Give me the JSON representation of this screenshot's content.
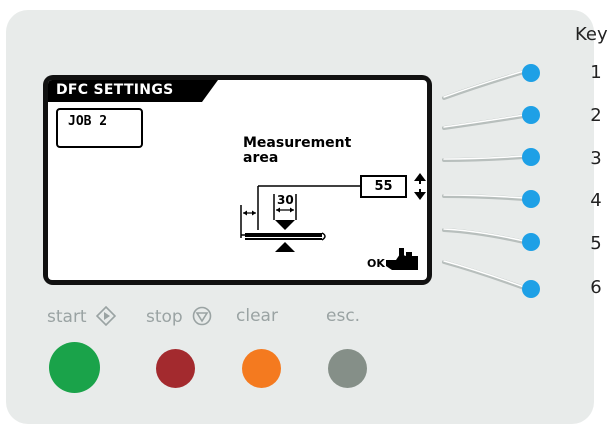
{
  "screen": {
    "title": "DFC SETTINGS",
    "job_label": "JOB  2",
    "measurement_line1": "Measurement",
    "measurement_line2": "area",
    "measurement_value": "55",
    "offset_value": "30",
    "ok_label": "OK"
  },
  "key": {
    "heading": "Key",
    "numbers": [
      "1",
      "2",
      "3",
      "4",
      "5",
      "6"
    ]
  },
  "buttons": {
    "start_label": "start",
    "stop_label": "stop",
    "clear_label": "clear",
    "esc_label": "esc.",
    "start_color": "#1aa34a",
    "stop_color": "#a32a2e",
    "clear_color": "#f47a1f",
    "esc_color": "#858f88"
  },
  "softkey_color": "#1ea0e6",
  "icons": {
    "start": "diamond-arrow-icon",
    "stop": "circle-triangle-icon",
    "ok": "pointing-hand-icon",
    "increment": "up-arrow-icon",
    "decrement": "down-arrow-icon"
  }
}
